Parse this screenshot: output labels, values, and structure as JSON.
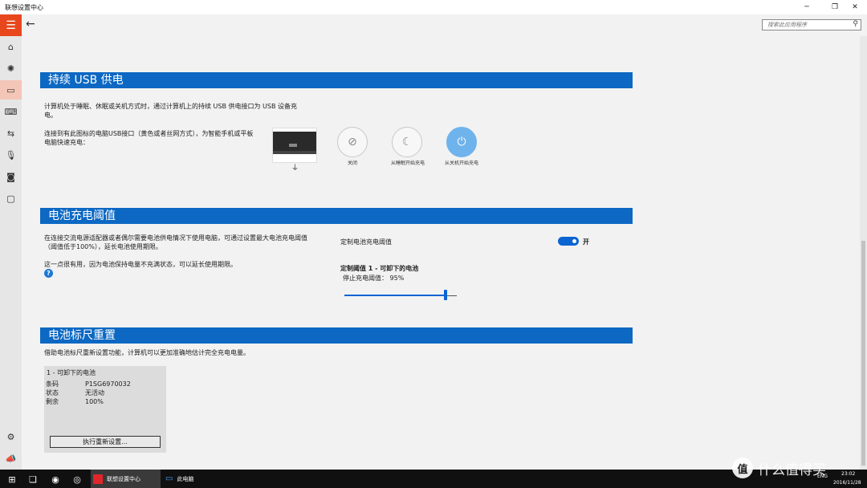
{
  "window": {
    "title": "联想设置中心"
  },
  "search": {
    "placeholder": "搜索此应用程序"
  },
  "usb": {
    "heading": "持续 USB 供电",
    "desc_line1": "计算机处于睡眠、休眠或关机方式时，通过计算机上的持续 USB 供电接口为 USB 设备充",
    "desc_line2": "电。",
    "port_line1": "连接到有此图标的电脑USB接口（黄色或者丝网方式），为智能手机或平板",
    "port_line2": "电脑快速充电：",
    "options": [
      {
        "label": "关闭",
        "icon": "usb-off-icon",
        "selected": false
      },
      {
        "label": "从睡眠开始充电",
        "icon": "usb-sleep-icon",
        "selected": false
      },
      {
        "label": "从关机开始充电",
        "icon": "usb-power-icon",
        "selected": true
      }
    ]
  },
  "threshold": {
    "heading": "电池充电阈值",
    "desc_line1": "在连接交流电源适配器或者偶尔需要电池供电情况下使用电脑，可通过设置最大电池充电阈值",
    "desc_line2": "（阈值低于100%），延长电池使用期限。",
    "desc_line3": "这一点很有用，因为电池保持电量不充满状态，可以延长使用期限。",
    "toggle_label": "定制电池充电阈值",
    "toggle_state": "开",
    "battery_title": "定制阈值 1 - 可卸下的电池",
    "stop_label": "停止充电阈值：",
    "stop_value": "95%",
    "slider_fraction": 0.9
  },
  "gauge": {
    "heading": "电池标尺重置",
    "desc": "借助电池标尺重新设置功能，计算机可以更加准确地估计完全充电电量。",
    "card_title": "1 - 可卸下的电池",
    "rows": [
      {
        "key": "条码",
        "value": "P1SG6970032"
      },
      {
        "key": "状态",
        "value": "无活动"
      },
      {
        "key": "剩余",
        "value": "100%"
      }
    ],
    "button_label": "执行重新设置..."
  },
  "taskbar": {
    "active_app": "联想设置中心",
    "this_pc": "此电脑",
    "lang": "ENG",
    "time": "23:02",
    "date": "2016/11/28"
  },
  "watermark": {
    "text": "什么值得买",
    "badge": "值"
  }
}
